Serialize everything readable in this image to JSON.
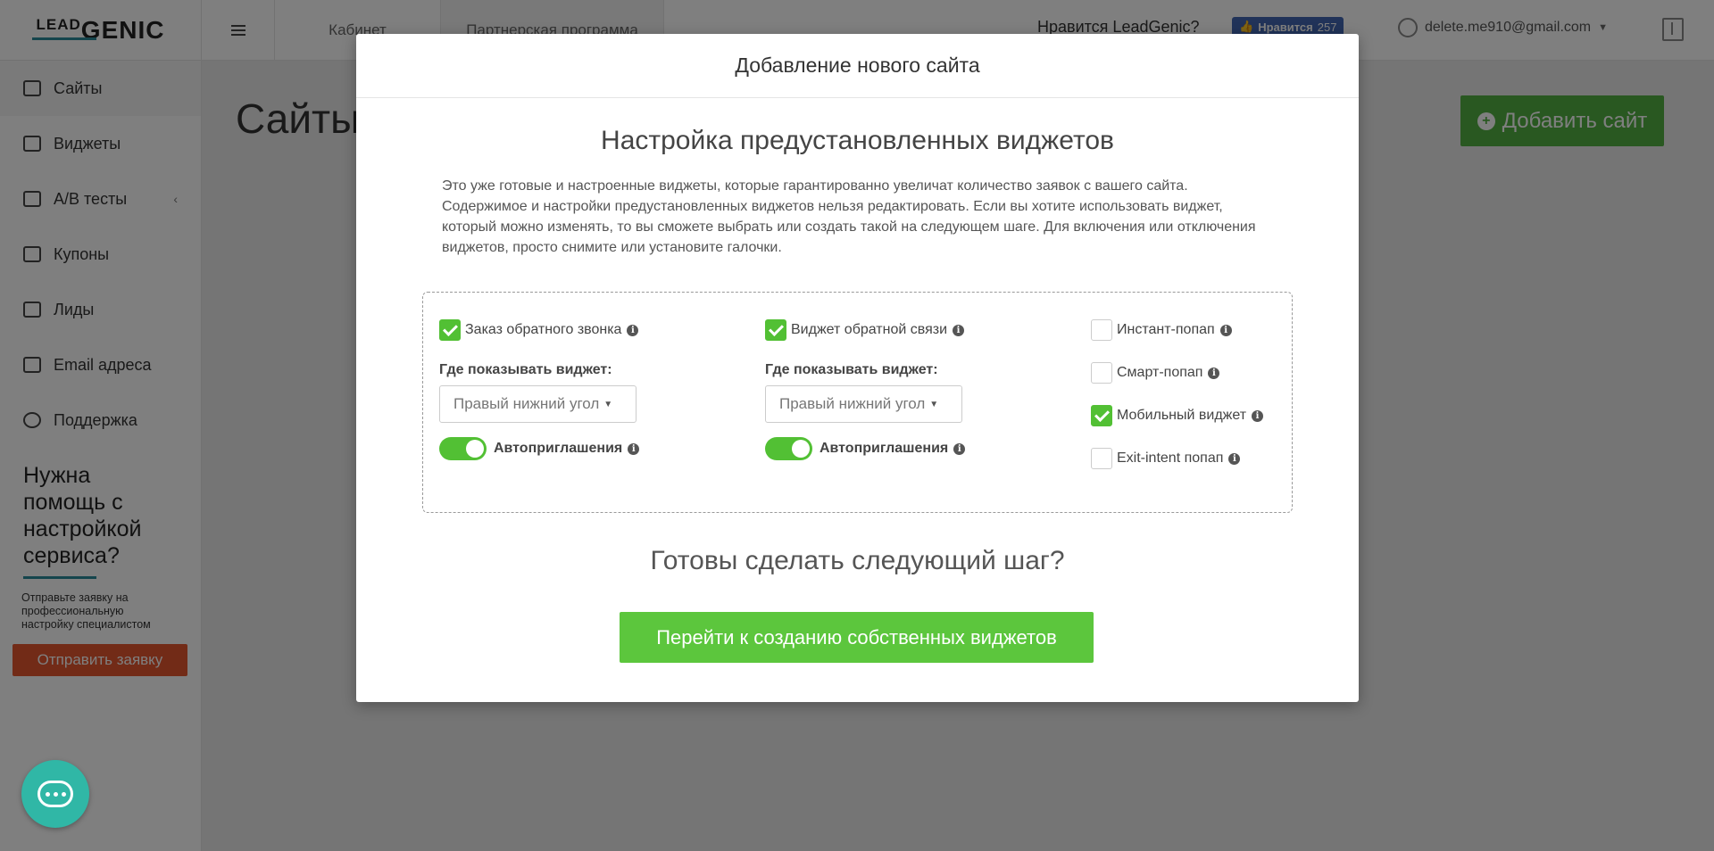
{
  "header": {
    "logo_top": "LEAD",
    "logo_bottom": "GENIC",
    "tabs": [
      {
        "label": "Кабинет"
      },
      {
        "label": "Партнерская программа"
      }
    ],
    "likes_text": "Нравится LeadGenic?",
    "fb_like_label": "Нравится",
    "fb_like_count": "257",
    "user_email": "delete.me910@gmail.com"
  },
  "sidebar": {
    "items": [
      {
        "label": "Сайты"
      },
      {
        "label": "Виджеты"
      },
      {
        "label": "A/B тесты"
      },
      {
        "label": "Купоны"
      },
      {
        "label": "Лиды"
      },
      {
        "label": "Email адреса"
      },
      {
        "label": "Поддержка"
      }
    ],
    "help_title": "Нужна помощь с настройкой сервиса?",
    "help_text": "Отправьте заявку на профессиональную настройку специалистом",
    "help_button": "Отправить заявку"
  },
  "main": {
    "title": "Сайты",
    "add_button": "Добавить сайт"
  },
  "modal": {
    "header": "Добавление нового сайта",
    "title": "Настройка предустановленных виджетов",
    "description": "Это уже готовые и настроенные виджеты, которые гарантированно увеличат количество заявок с вашего сайта. Содержимое и настройки предустановленных виджетов нельзя редактировать. Если вы хотите использовать виджет, который можно изменять, то вы сможете выбрать или создать такой на следующем шаге. Для включения или отключения виджетов, просто снимите или установите галочки.",
    "widget1": {
      "label": "Заказ обратного звонка",
      "checked": true,
      "where_label": "Где показывать виджет:",
      "position": "Правый нижний угол",
      "auto_label": "Автоприглашения",
      "auto_on": true
    },
    "widget2": {
      "label": "Виджет обратной связи",
      "checked": true,
      "where_label": "Где показывать виджет:",
      "position": "Правый нижний угол",
      "auto_label": "Автоприглашения",
      "auto_on": true
    },
    "extra_widgets": [
      {
        "label": "Инстант-попап",
        "checked": false
      },
      {
        "label": "Смарт-попап",
        "checked": false
      },
      {
        "label": "Мобильный виджет",
        "checked": true
      },
      {
        "label": "Exit-intent попап",
        "checked": false
      }
    ],
    "next_title": "Готовы сделать следующий шаг?",
    "next_button": "Перейти к созданию собственных виджетов"
  },
  "colors": {
    "accent_green": "#52c034",
    "sidebar_accent": "#2a8a9a",
    "help_button": "#e5562f",
    "chat_bubble": "#30b7a6"
  }
}
